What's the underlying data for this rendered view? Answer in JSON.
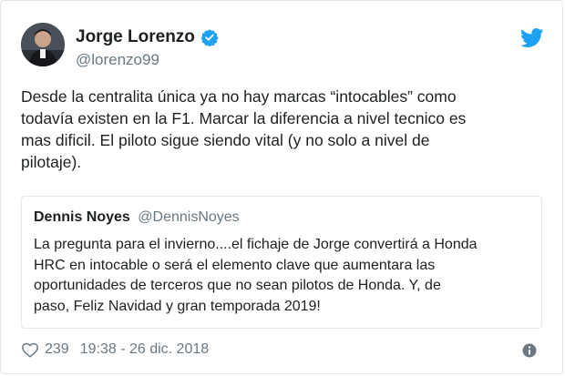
{
  "tweet": {
    "author_name": "Jorge Lorenzo",
    "author_handle": "@lorenzo99",
    "text": "Desde la centralita única ya no hay marcas “intocables” como\ntodavía existen en la F1. Marcar la diferencia a nivel tecnico es\nmas dificil. El piloto sigue siendo vital (y no solo a nivel de\npilotaje).",
    "likes": "239",
    "timestamp": "19:38 - 26 dic. 2018"
  },
  "quoted": {
    "author_name": "Dennis Noyes",
    "author_handle": "@DennisNoyes",
    "text": "La pregunta para el invierno....el fichaje de Jorge convertirá a Honda\nHRC en intocable o será el elemento clave que aumentara las\noportunidades de terceros que no sean pilotos de Honda. Y, de\npaso, Feliz Navidad y gran temporada 2019!"
  },
  "colors": {
    "twitter_blue": "#1da1f2",
    "secondary_text": "#697882",
    "border": "#e1e8ed"
  },
  "icons": {
    "verified": "verified-badge-icon",
    "brand": "twitter-bird-icon",
    "like": "heart-icon",
    "info": "info-icon"
  }
}
